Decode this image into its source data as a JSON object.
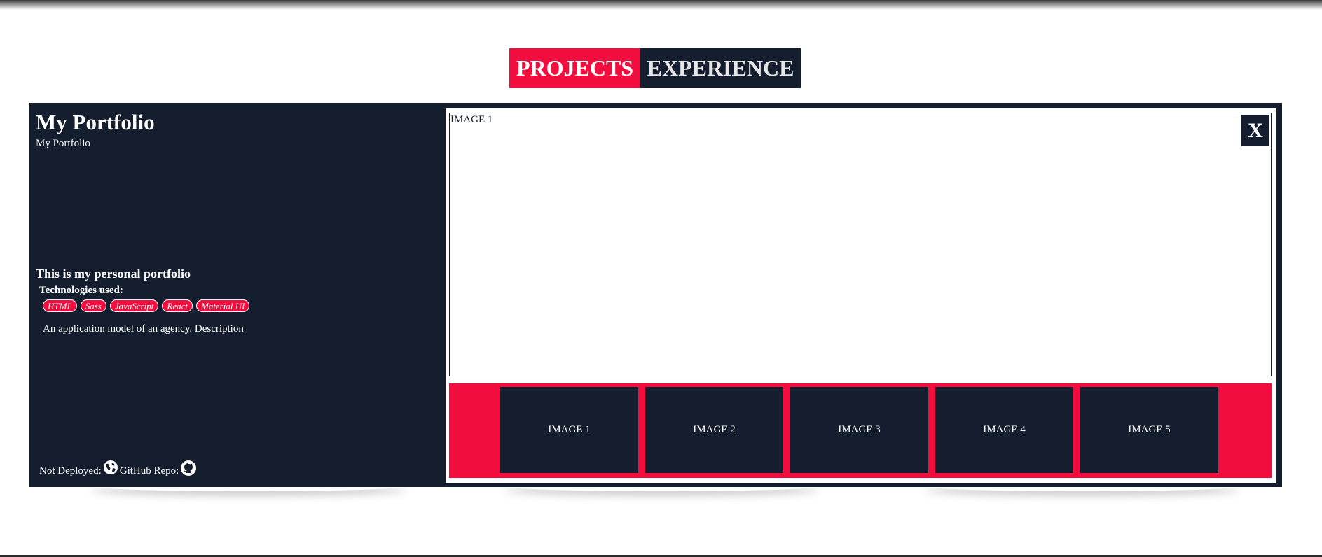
{
  "tabs": [
    {
      "label": "PROJECTS",
      "active": true
    },
    {
      "label": "EXPERIENCE",
      "active": false
    }
  ],
  "colors": {
    "accent": "#f10e3e",
    "dark": "#151e2f",
    "background": "#ffffff"
  },
  "project": {
    "title": "My Portfolio",
    "subtitle": "My Portfolio",
    "headline": "This is my personal portfolio",
    "tech_label": "Technologies used:",
    "technologies": [
      "HTML",
      "Sass",
      "JavaScript",
      "React",
      "Material UI"
    ],
    "description": "An application model of an agency. Description",
    "deploy_label": "Not Deployed:",
    "deploy_icon": "globe-icon",
    "repo_label": "GitHub Repo:",
    "repo_icon": "github-icon"
  },
  "viewer": {
    "current_image": "IMAGE 1",
    "close_label": "X",
    "thumbnails": [
      "IMAGE 1",
      "IMAGE 2",
      "IMAGE 3",
      "IMAGE 4",
      "IMAGE 5"
    ]
  }
}
